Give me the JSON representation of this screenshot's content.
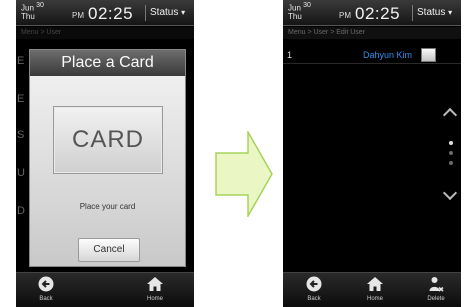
{
  "left_screen": {
    "statusbar": {
      "month": "Jun",
      "date": "30",
      "weekday": "Thu",
      "ampm": "PM",
      "time": "02:25",
      "status_label": "Status",
      "status_caret": "▾"
    },
    "breadcrumb": "Menu > User",
    "modal": {
      "title": "Place a Card",
      "card_label": "CARD",
      "instruction": "Place your card",
      "cancel_label": "Cancel"
    },
    "bottombar": {
      "back_label": "Back",
      "home_label": "Home"
    }
  },
  "right_screen": {
    "statusbar": {
      "month": "Jun",
      "date": "30",
      "weekday": "Thu",
      "ampm": "PM",
      "time": "02:25",
      "status_label": "Status",
      "status_caret": "▾"
    },
    "breadcrumb": "Menu > User > Edit User",
    "user_list": [
      {
        "number": "1",
        "name": "Dahyun Kim",
        "checked": false
      }
    ],
    "bottombar": {
      "back_label": "Back",
      "home_label": "Home",
      "delete_label": "Delete"
    }
  },
  "colors": {
    "accent_blue": "#2e8ef0",
    "arrow_fill": "#eaf7c4",
    "arrow_stroke": "#a7d35a"
  },
  "icons": [
    "back-arrow-icon",
    "home-icon",
    "delete-user-icon",
    "transition-arrow-icon"
  ]
}
